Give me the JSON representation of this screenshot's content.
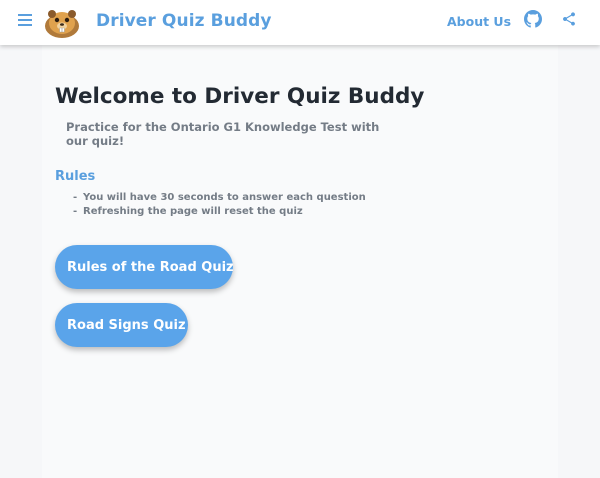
{
  "header": {
    "menu_icon": "hamburger-menu-icon",
    "logo_icon": "beaver-logo-icon",
    "title": "Driver Quiz Buddy",
    "about_label": "About Us",
    "github_icon": "github-icon",
    "share_icon": "share-icon",
    "accent_color": "#5a9fde"
  },
  "main": {
    "welcome": "Welcome to Driver Quiz Buddy",
    "subtitle": "Practice for the Ontario G1 Knowledge Test with our quiz!",
    "rules": {
      "heading": "Rules",
      "items": [
        "You will have 30 seconds to answer each question",
        "Refreshing the page will reset the quiz"
      ]
    },
    "buttons": {
      "rules_quiz": "Rules of the Road Quiz",
      "signs_quiz": "Road Signs Quiz"
    },
    "button_color": "#5aa4ea"
  }
}
